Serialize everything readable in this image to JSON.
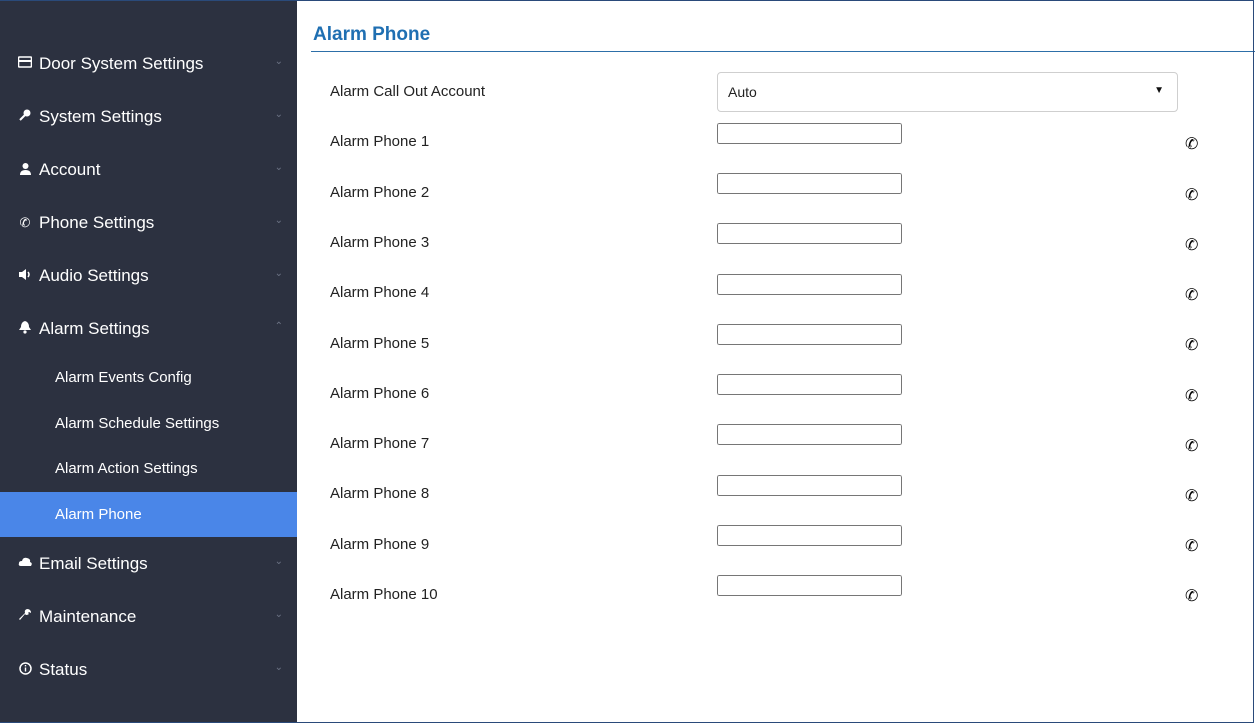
{
  "sidebar": {
    "items": [
      {
        "label": "Door System Settings",
        "icon": "card-icon"
      },
      {
        "label": "System Settings",
        "icon": "key-icon"
      },
      {
        "label": "Account",
        "icon": "user-icon"
      },
      {
        "label": "Phone Settings",
        "icon": "phone-icon"
      },
      {
        "label": "Audio Settings",
        "icon": "speaker-icon"
      },
      {
        "label": "Alarm Settings",
        "icon": "bell-icon",
        "expanded": true
      }
    ],
    "sub_items": [
      {
        "label": "Alarm Events Config"
      },
      {
        "label": "Alarm Schedule Settings"
      },
      {
        "label": "Alarm Action Settings"
      },
      {
        "label": "Alarm Phone",
        "active": true
      }
    ],
    "items_after": [
      {
        "label": "Email Settings",
        "icon": "cloud-icon"
      },
      {
        "label": "Maintenance",
        "icon": "wrench-icon"
      },
      {
        "label": "Status",
        "icon": "info-icon"
      }
    ],
    "active_color": "#4a86e8",
    "background_color": "#2c3140"
  },
  "main": {
    "title": "Alarm Phone",
    "title_color": "#1f6fb2",
    "call_out_account": {
      "label": "Alarm Call Out Account",
      "value": "Auto"
    },
    "phones": [
      {
        "label": "Alarm Phone 1",
        "value": ""
      },
      {
        "label": "Alarm Phone 2",
        "value": ""
      },
      {
        "label": "Alarm Phone 3",
        "value": ""
      },
      {
        "label": "Alarm Phone 4",
        "value": ""
      },
      {
        "label": "Alarm Phone 5",
        "value": ""
      },
      {
        "label": "Alarm Phone 6",
        "value": ""
      },
      {
        "label": "Alarm Phone 7",
        "value": ""
      },
      {
        "label": "Alarm Phone 8",
        "value": ""
      },
      {
        "label": "Alarm Phone 9",
        "value": ""
      },
      {
        "label": "Alarm Phone 10",
        "value": ""
      }
    ]
  }
}
